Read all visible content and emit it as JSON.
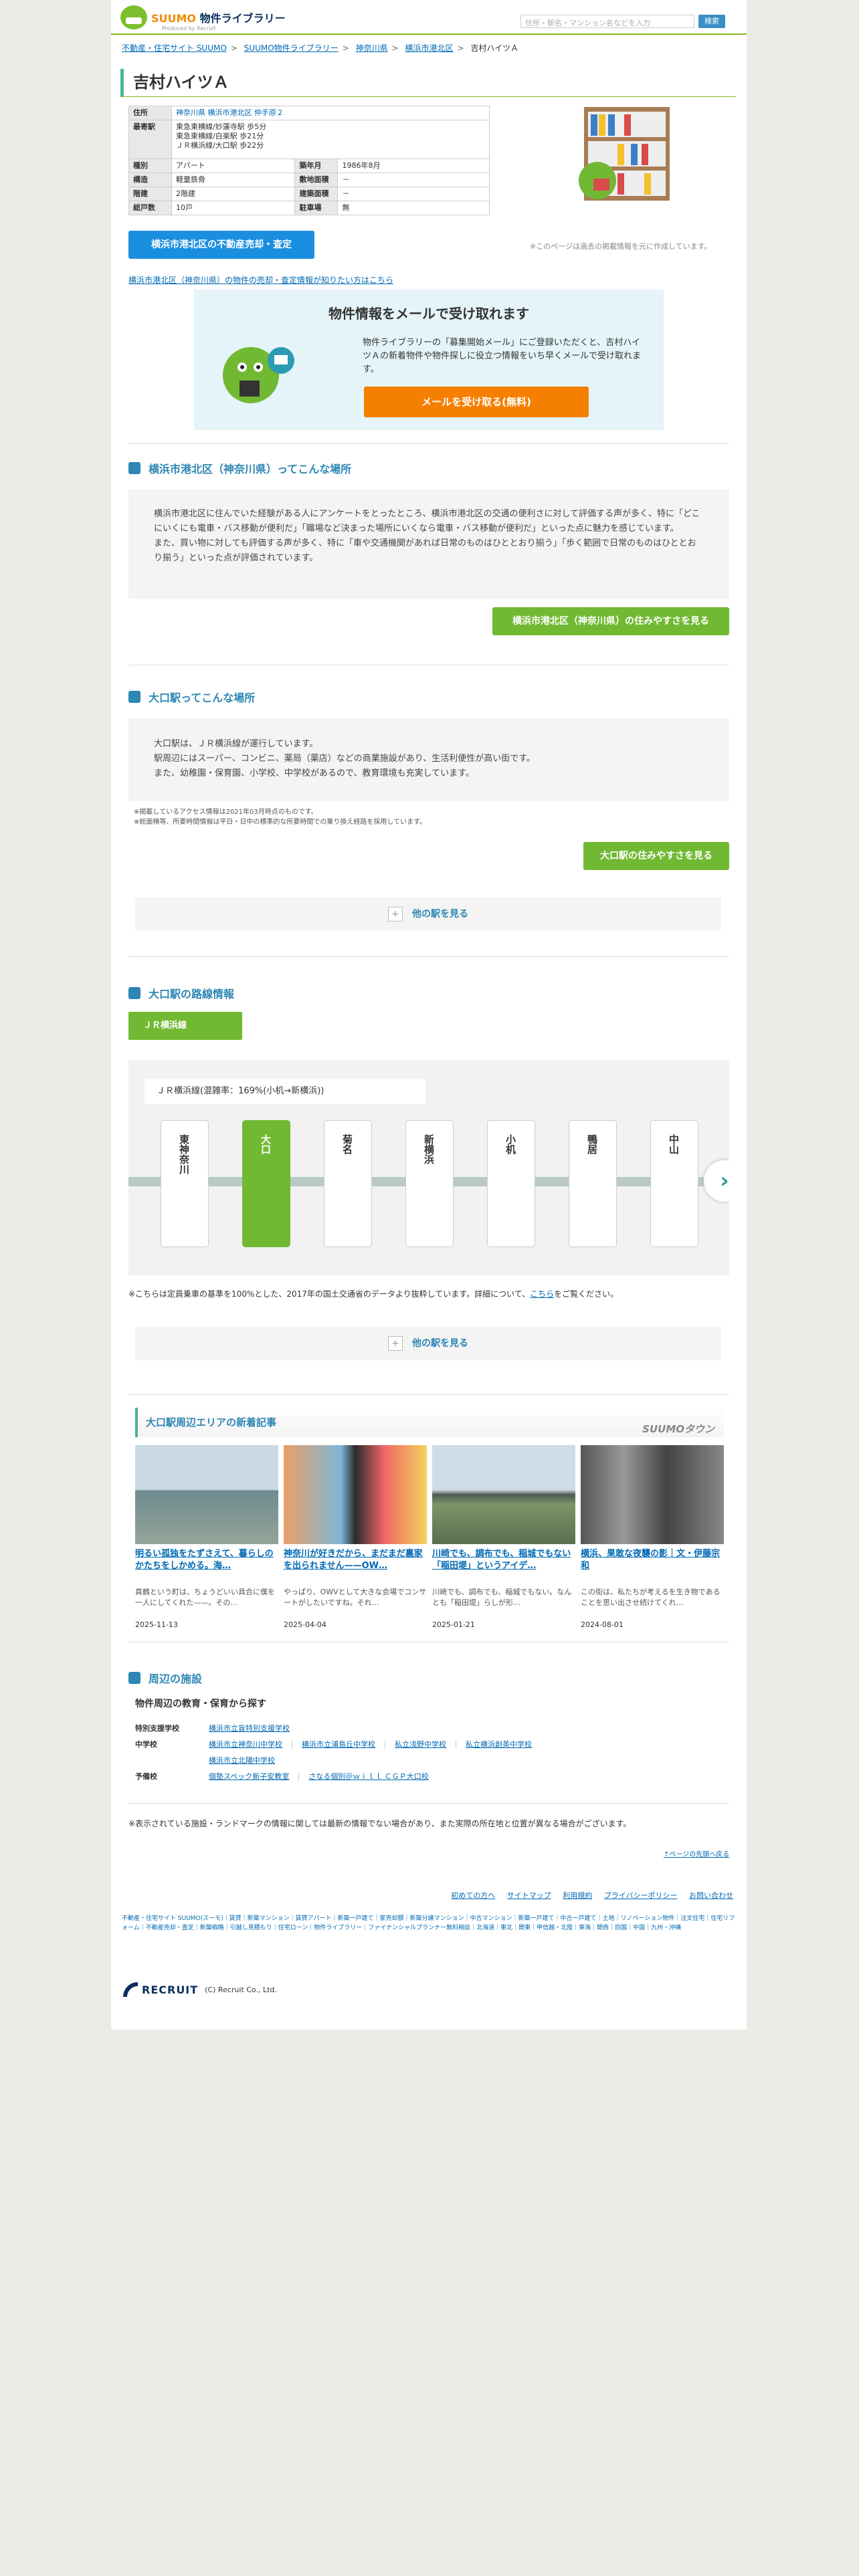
{
  "header": {
    "brand_suumo": "SUUMO",
    "brand_service": "物件ライブラリー",
    "brand_sub": "Produced by Recruit",
    "search_placeholder": "住所・駅名・マンション名などを入力",
    "search_button": "検索"
  },
  "breadcrumb": [
    "不動産・住宅サイト SUUMO",
    "SUUMO物件ライブラリー",
    "神奈川県",
    "横浜市港北区",
    "吉村ハイツＡ"
  ],
  "property": {
    "name": "吉村ハイツＡ",
    "rows": [
      {
        "k1": "住所",
        "v1": "神奈川県 横浜市港北区 仲手原２",
        "k2": "",
        "v2": ""
      },
      {
        "k1": "最寄駅",
        "v1": "東急東横線/妙蓮寺駅 歩5分\n東急東横線/白楽駅 歩21分\nＪＲ横浜線/大口駅 歩22分",
        "k2": "",
        "v2": ""
      },
      {
        "k1": "種別",
        "v1": "アパート",
        "k2": "築年月",
        "v2": "1986年8月"
      },
      {
        "k1": "構造",
        "v1": "軽量鉄骨",
        "k2": "敷地面積",
        "v2": "－"
      },
      {
        "k1": "階建",
        "v1": "2階建",
        "k2": "建築面積",
        "v2": "－"
      },
      {
        "k1": "総戸数",
        "v1": "10戸",
        "k2": "駐車場",
        "v2": "無"
      }
    ],
    "past_note": "※このページは過去の掲載情報を元に作成しています。",
    "sell_button": "横浜市港北区の不動産売却・査定",
    "sell_link": "横浜市港北区（神奈川県）の物件の売却・査定情報が知りたい方はこちら"
  },
  "mail": {
    "title": "物件情報をメールで受け取れます",
    "text": "物件ライブラリーの「募集開始メール」にご登録いただくと、吉村ハイツＡの新着物件や物件探しに役立つ情報をいち早くメールで受け取れます。",
    "button": "メールを受け取る(無料)"
  },
  "area": {
    "heading": "横浜市港北区（神奈川県）ってこんな場所",
    "text": "横浜市港北区に住んでいた経験がある人にアンケートをとったところ、横浜市港北区の交通の便利さに対して評価する声が多く、特に「どこにいくにも電車・バス移動が便利だ」「職場など決まった場所にいくなら電車・バス移動が便利だ」といった点に魅力を感じています。\nまた、買い物に対しても評価する声が多く、特に「車や交通機関があれば日常のものはひととおり揃う」「歩く範囲で日常のものはひととおり揃う」といった点が評価されています。",
    "button": "横浜市港北区（神奈川県）の住みやすさを見る"
  },
  "station": {
    "heading": "大口駅ってこんな場所",
    "text": "大口駅は、ＪＲ横浜線が運行しています。\n駅周辺にはスーパー、コンビニ、薬局（薬店）などの商業施設があり、生活利便性が高い街です。\nまた、幼稚園・保育園、小学校、中学校があるので、教育環境も充実しています。",
    "notes": "※掲載しているアクセス情報は2021年03月時点のものです。\n※総面積等、所要時間情報は平日・日中の標準的な所要時間での乗り換え経路を採用しています。",
    "button": "大口駅の住みやすさを見る",
    "more": "他の駅を見る"
  },
  "route": {
    "heading": "大口駅の路線情報",
    "tab": "ＪＲ横浜線",
    "line_label": "ＪＲ横浜線(混雑率：169%(小机→新横浜))",
    "stations": [
      "東神奈川",
      "大口",
      "菊名",
      "新横浜",
      "小机",
      "鴨居",
      "中山"
    ],
    "current": "大口",
    "note_pre": "※こちらは定員乗車の基準を100%とした、2017年の国土交通省のデータより抜粋しています。詳細について、",
    "note_link": "こちら",
    "note_post": "をご覧ください。",
    "more": "他の駅を見る"
  },
  "news": {
    "heading": "大口駅周辺エリアの新着記事",
    "logo": "SUUMOタウン",
    "articles": [
      {
        "title": "明るい孤独をたずさえて、暮らしのかたちをしかめる。海…",
        "desc": "真鶴という町は、ちょうどいい具合に僕を一人にしてくれた——。その…",
        "date": "2025-11-13"
      },
      {
        "title": "神奈川が好きだから、まだまだ裏家を出られません——OW…",
        "desc": "やっぱり、OWVとして大きな会場でコンサートがしたいですね。それ…",
        "date": "2025-04-04"
      },
      {
        "title": "川崎でも、調布でも、稲城でもない「稲田堤」というアイデ…",
        "desc": "川崎でも、調布でも、稲城でもない。なんとも「稲田堤」らしが形…",
        "date": "2025-01-21"
      },
      {
        "title": "横浜、果敢な夜襲の影｜文・伊藤宗和",
        "desc": "この街は、私たちが考えるを生き物であることを思い出させ続けてくれ…",
        "date": "2024-08-01"
      }
    ]
  },
  "facilities": {
    "heading": "周辺の施設",
    "sub": "物件周辺の教育・保育から探す",
    "rows": [
      {
        "label": "特別支援学校",
        "items": [
          "横浜市立盲特別支援学校"
        ]
      },
      {
        "label": "中学校",
        "items": [
          "横浜市立神奈川中学校",
          "横浜市立浦島丘中学校",
          "私立浅野中学校",
          "私立横浜創英中学校"
        ]
      },
      {
        "label": "",
        "items": [
          "横浜市立北陽中学校"
        ]
      },
      {
        "label": "予備校",
        "items": [
          "個塾スペック新子安教室",
          "さなる個別＠ｗｉｌｌ ＣＧＰ大口校"
        ]
      }
    ],
    "note": "※表示されている施設・ランドマークの情報に関しては最新の情報でない場合があり、また実際の所在地と位置が異なる場合がございます。",
    "top_link": "↑ページの先頭へ戻る"
  },
  "footer": {
    "nav": [
      "初めての方へ",
      "サイトマップ",
      "利用規約",
      "プライバシーポリシー",
      "お問い合わせ"
    ],
    "links": "不動産・住宅サイト SUUMO(スーモ)｜賃貸｜新築マンション｜賃貸アパート｜新築一戸建て｜家売却額｜新築分譲マンション｜中古マンション｜新築一戸建て｜中古一戸建て｜土地｜リノベーション物件｜注文住宅｜住宅リフォーム｜不動産売却・査定｜新築戦略｜引越し見積もり｜住宅ローン｜物件ライブラリー｜ファイナンシャルプランナー無料相談｜北海道｜東北｜関東｜甲信越・北陸｜東海｜関西｜四国｜中国｜九州・沖縄",
    "recruit": "RECRUIT",
    "copyright": "(C) Recruit Co., Ltd."
  },
  "colors": {
    "green": "#72b933",
    "blue": "#1a8fe0",
    "orange": "#f57f00",
    "teal": "#2d86b4"
  }
}
